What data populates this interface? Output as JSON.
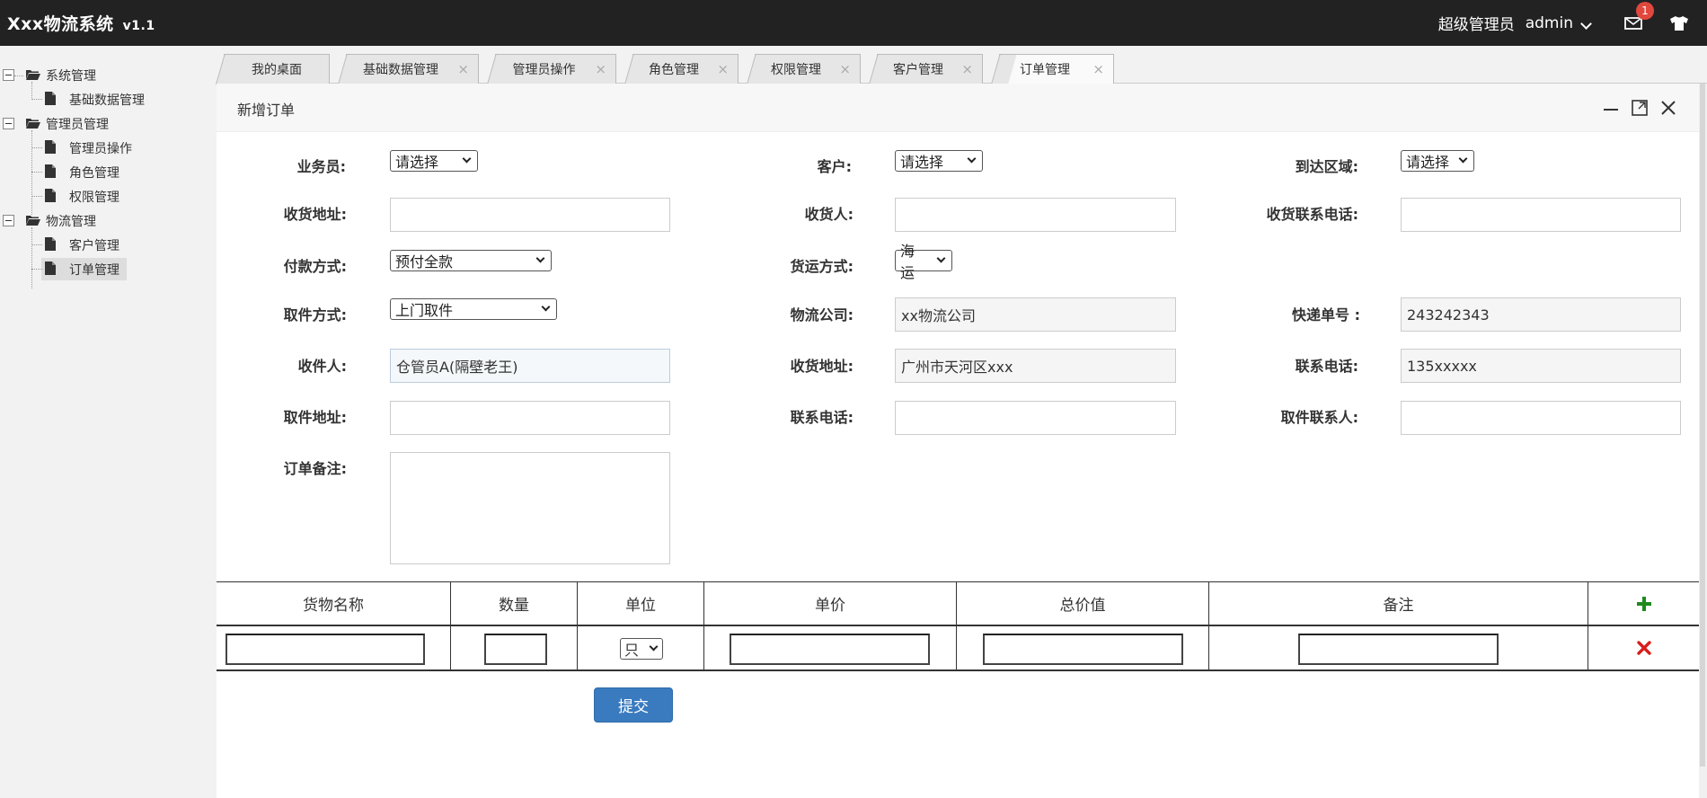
{
  "header": {
    "brand": "Xxx物流系统",
    "version": "v1.1",
    "role": "超级管理员",
    "username": "admin",
    "mail_badge": "1",
    "icons": [
      "envelope-icon",
      "shirt-icon",
      "chevron-down-icon"
    ]
  },
  "sidebar": {
    "groups": [
      {
        "label": "系统管理",
        "children": [
          "基础数据管理"
        ]
      },
      {
        "label": "管理员管理",
        "children": [
          "管理员操作",
          "角色管理",
          "权限管理"
        ]
      },
      {
        "label": "物流管理",
        "children": [
          "客户管理",
          "订单管理"
        ]
      }
    ],
    "active": "订单管理"
  },
  "tabs": [
    {
      "label": "我的桌面",
      "closable": false
    },
    {
      "label": "基础数据管理",
      "closable": true
    },
    {
      "label": "管理员操作",
      "closable": true
    },
    {
      "label": "角色管理",
      "closable": true
    },
    {
      "label": "权限管理",
      "closable": true
    },
    {
      "label": "客户管理",
      "closable": true
    },
    {
      "label": "订单管理",
      "closable": true,
      "active": true
    }
  ],
  "tab_close_glyph": "×",
  "panel": {
    "title": "新增订单"
  },
  "form": {
    "salesman_label": "业务员:",
    "salesman_value": "请选择",
    "customer_label": "客户:",
    "customer_value": "请选择",
    "area_label": "到达区域:",
    "area_value": "请选择",
    "ship_addr_label": "收货地址:",
    "ship_addr_value": "",
    "receiver_label": "收货人:",
    "receiver_value": "",
    "receiver_phone_label": "收货联系电话:",
    "receiver_phone_value": "",
    "payment_label": "付款方式:",
    "payment_value": "预付全款",
    "transport_label": "货运方式:",
    "transport_value": "海运",
    "pickup_method_label": "取件方式:",
    "pickup_method_value": "上门取件",
    "logistics_label": "物流公司:",
    "logistics_value": "xx物流公司",
    "tracking_label": "快递单号 :",
    "tracking_value": "243242343",
    "collector_label": "收件人:",
    "collector_value": "仓管员A(隔壁老王)",
    "deliver_addr_label": "收货地址:",
    "deliver_addr_value": "广州市天河区xxx",
    "contact_phone_label": "联系电话:",
    "contact_phone_value": "135xxxxx",
    "pickup_addr_label": "取件地址:",
    "pickup_addr_value": "",
    "pickup_phone_label": "联系电话:",
    "pickup_phone_value": "",
    "pickup_contact_label": "取件联系人:",
    "pickup_contact_value": "",
    "remark_label": "订单备注:",
    "remark_value": ""
  },
  "goods_table": {
    "columns": [
      "货物名称",
      "数量",
      "单位",
      "单价",
      "总价值",
      "备注"
    ],
    "unit_value": "只",
    "add_icon": "plus-icon",
    "delete_icon": "close-icon"
  },
  "submit_label": "提交"
}
